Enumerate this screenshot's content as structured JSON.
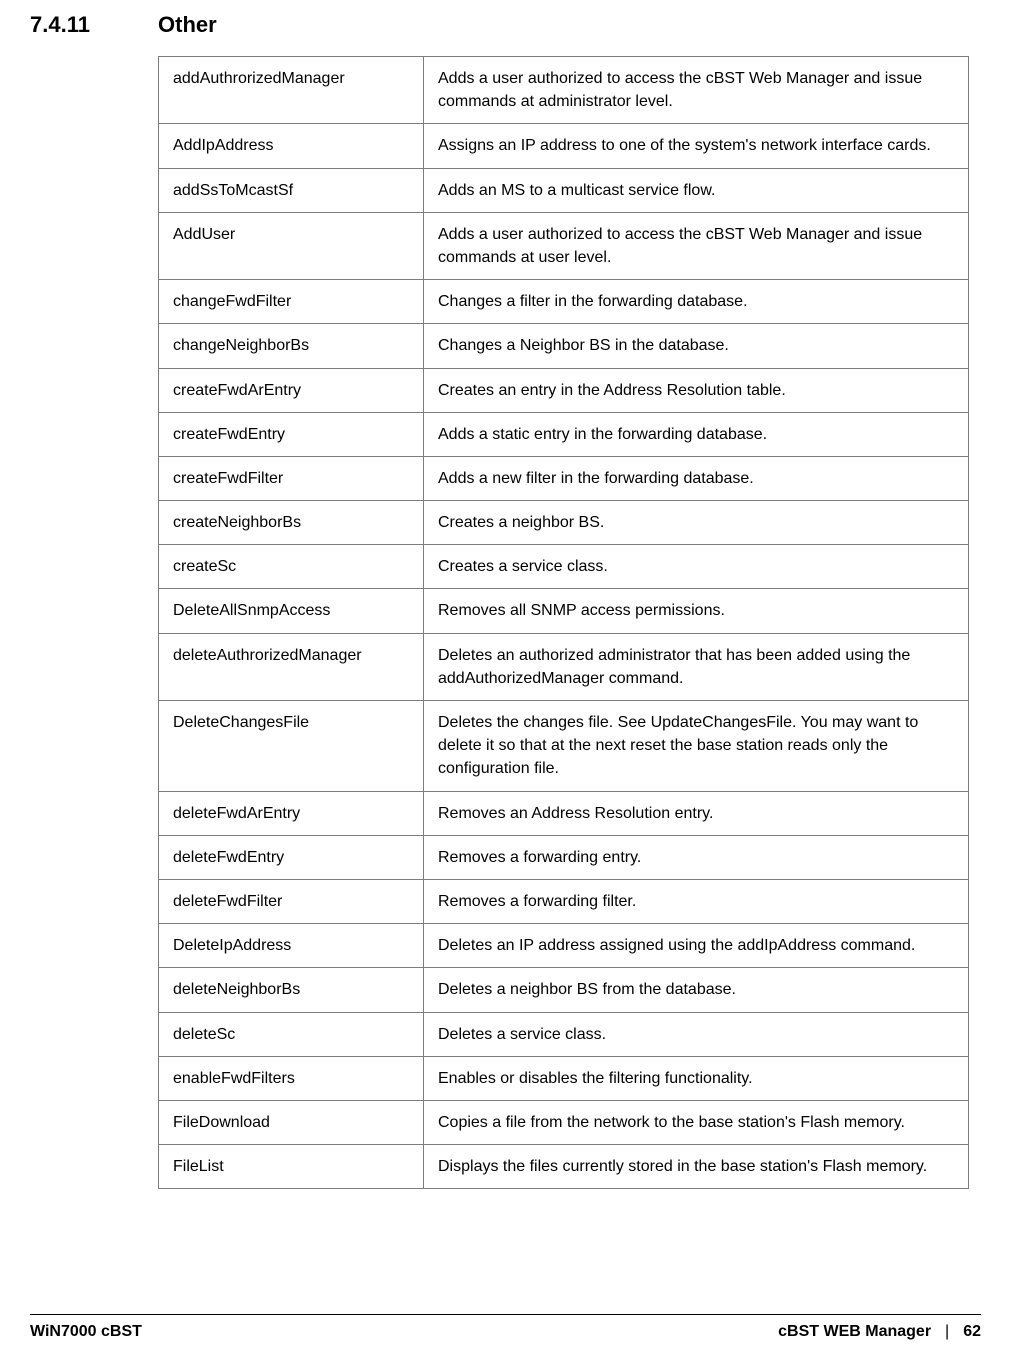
{
  "section": {
    "number": "7.4.11",
    "title": "Other"
  },
  "rows": [
    {
      "cmd": "addAuthrorizedManager",
      "desc": "Adds a user authorized to access the cBST Web Manager and issue commands at administrator level."
    },
    {
      "cmd": "AddIpAddress",
      "desc": "Assigns an IP address to one of the system's network interface cards."
    },
    {
      "cmd": "addSsToMcastSf",
      "desc": "Adds an MS to a multicast service flow."
    },
    {
      "cmd": "AddUser",
      "desc": "Adds a user authorized to access the cBST Web Manager and issue commands at user level."
    },
    {
      "cmd": "changeFwdFilter",
      "desc": "Changes a filter in the forwarding database."
    },
    {
      "cmd": "changeNeighborBs",
      "desc": "Changes a Neighbor BS in the database."
    },
    {
      "cmd": "createFwdArEntry",
      "desc": "Creates an entry in the Address Resolution table."
    },
    {
      "cmd": "createFwdEntry",
      "desc": "Adds a static entry in the forwarding database."
    },
    {
      "cmd": "createFwdFilter",
      "desc": "Adds a new filter in the forwarding database."
    },
    {
      "cmd": "createNeighborBs",
      "desc": "Creates a neighbor BS."
    },
    {
      "cmd": "createSc",
      "desc": "Creates a service class."
    },
    {
      "cmd": "DeleteAllSnmpAccess",
      "desc": "Removes all SNMP access permissions."
    },
    {
      "cmd": "deleteAuthrorizedManager",
      "desc": "Deletes an authorized administrator that has been added using the addAuthorizedManager command."
    },
    {
      "cmd": "DeleteChangesFile",
      "desc": "Deletes the changes file. See UpdateChangesFile. You may want to delete it so that at the next reset the base station reads only the configuration file."
    },
    {
      "cmd": "deleteFwdArEntry",
      "desc": "Removes an Address Resolution entry."
    },
    {
      "cmd": "deleteFwdEntry",
      "desc": "Removes a forwarding entry."
    },
    {
      "cmd": "deleteFwdFilter",
      "desc": "Removes a forwarding filter."
    },
    {
      "cmd": "DeleteIpAddress",
      "desc": "Deletes an IP address assigned using the addIpAddress command."
    },
    {
      "cmd": "deleteNeighborBs",
      "desc": "Deletes a neighbor BS from the database."
    },
    {
      "cmd": "deleteSc",
      "desc": "Deletes a service class."
    },
    {
      "cmd": "enableFwdFilters",
      "desc": "Enables or disables the filtering functionality."
    },
    {
      "cmd": "FileDownload",
      "desc": "Copies a file from the network to the base station's Flash memory."
    },
    {
      "cmd": "FileList",
      "desc": "Displays the files currently stored in the base station's Flash memory."
    }
  ],
  "footer": {
    "product": "WiN7000 cBST",
    "manager": "cBST WEB Manager",
    "separator": "|",
    "page": "62"
  }
}
